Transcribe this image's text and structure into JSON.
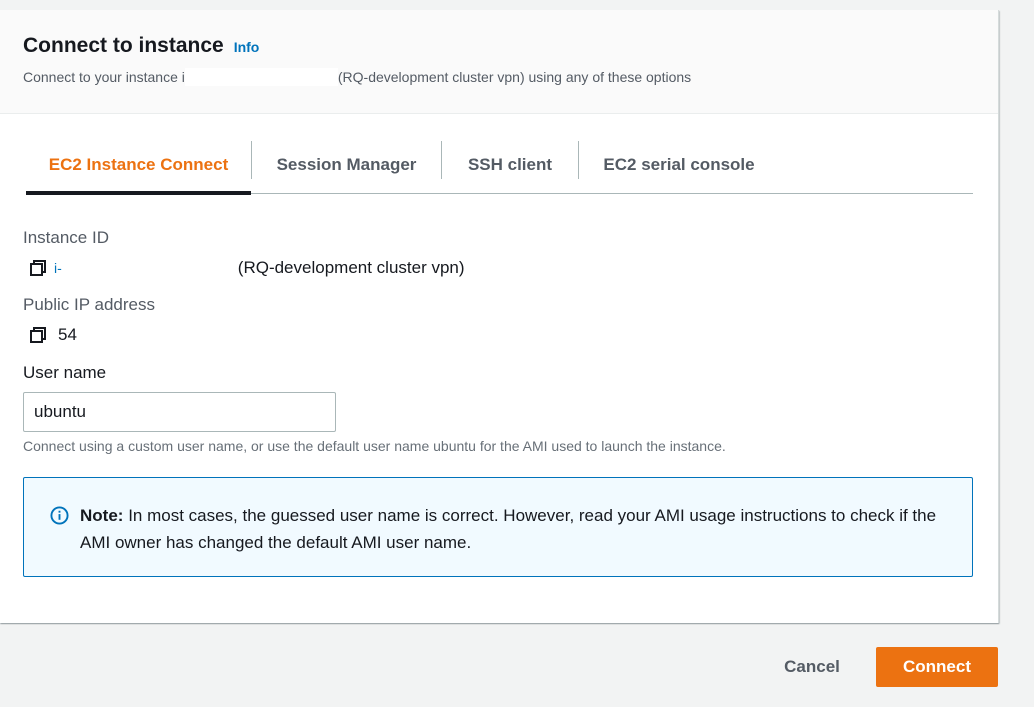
{
  "header": {
    "title": "Connect to instance",
    "info_label": "Info",
    "subtitle_prefix": "Connect to your instance i",
    "subtitle_suffix": "(RQ-development cluster vpn) using any of these options"
  },
  "tabs": [
    {
      "label": "EC2 Instance Connect",
      "active": true
    },
    {
      "label": "Session Manager",
      "active": false
    },
    {
      "label": "SSH client",
      "active": false
    },
    {
      "label": "EC2 serial console",
      "active": false
    }
  ],
  "instance": {
    "id_label": "Instance ID",
    "id_value": "i-",
    "name": "(RQ-development cluster vpn)",
    "ip_label": "Public IP address",
    "ip_value": "54"
  },
  "username": {
    "label": "User name",
    "value": "ubuntu",
    "hint": "Connect using a custom user name, or use the default user name ubuntu for the AMI used to launch the instance."
  },
  "note": {
    "bold": "Note:",
    "text": "In most cases, the guessed user name is correct. However, read your AMI usage instructions to check if the AMI owner has changed the default AMI user name."
  },
  "footer": {
    "cancel_label": "Cancel",
    "connect_label": "Connect"
  },
  "colors": {
    "accent": "#ec7211",
    "link": "#0073bb",
    "note_bg": "#f1faff"
  },
  "icons": {
    "copy": "copy-icon",
    "info": "info-circle-icon"
  }
}
